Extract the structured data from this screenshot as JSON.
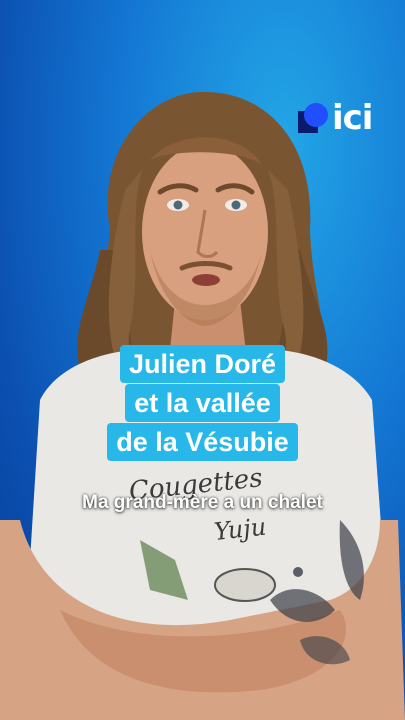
{
  "brand": {
    "logo_text": "ici",
    "colors": {
      "mark_circle": "#1f4fff",
      "mark_square": "#0c1a6e"
    }
  },
  "title": {
    "lines": [
      "Julien Doré",
      "et la vallée",
      "de la Vésubie"
    ],
    "highlight_color": "#27b7e8"
  },
  "caption": "Ma grand-mère a un chalet",
  "background": {
    "accent": "#1478d4"
  }
}
